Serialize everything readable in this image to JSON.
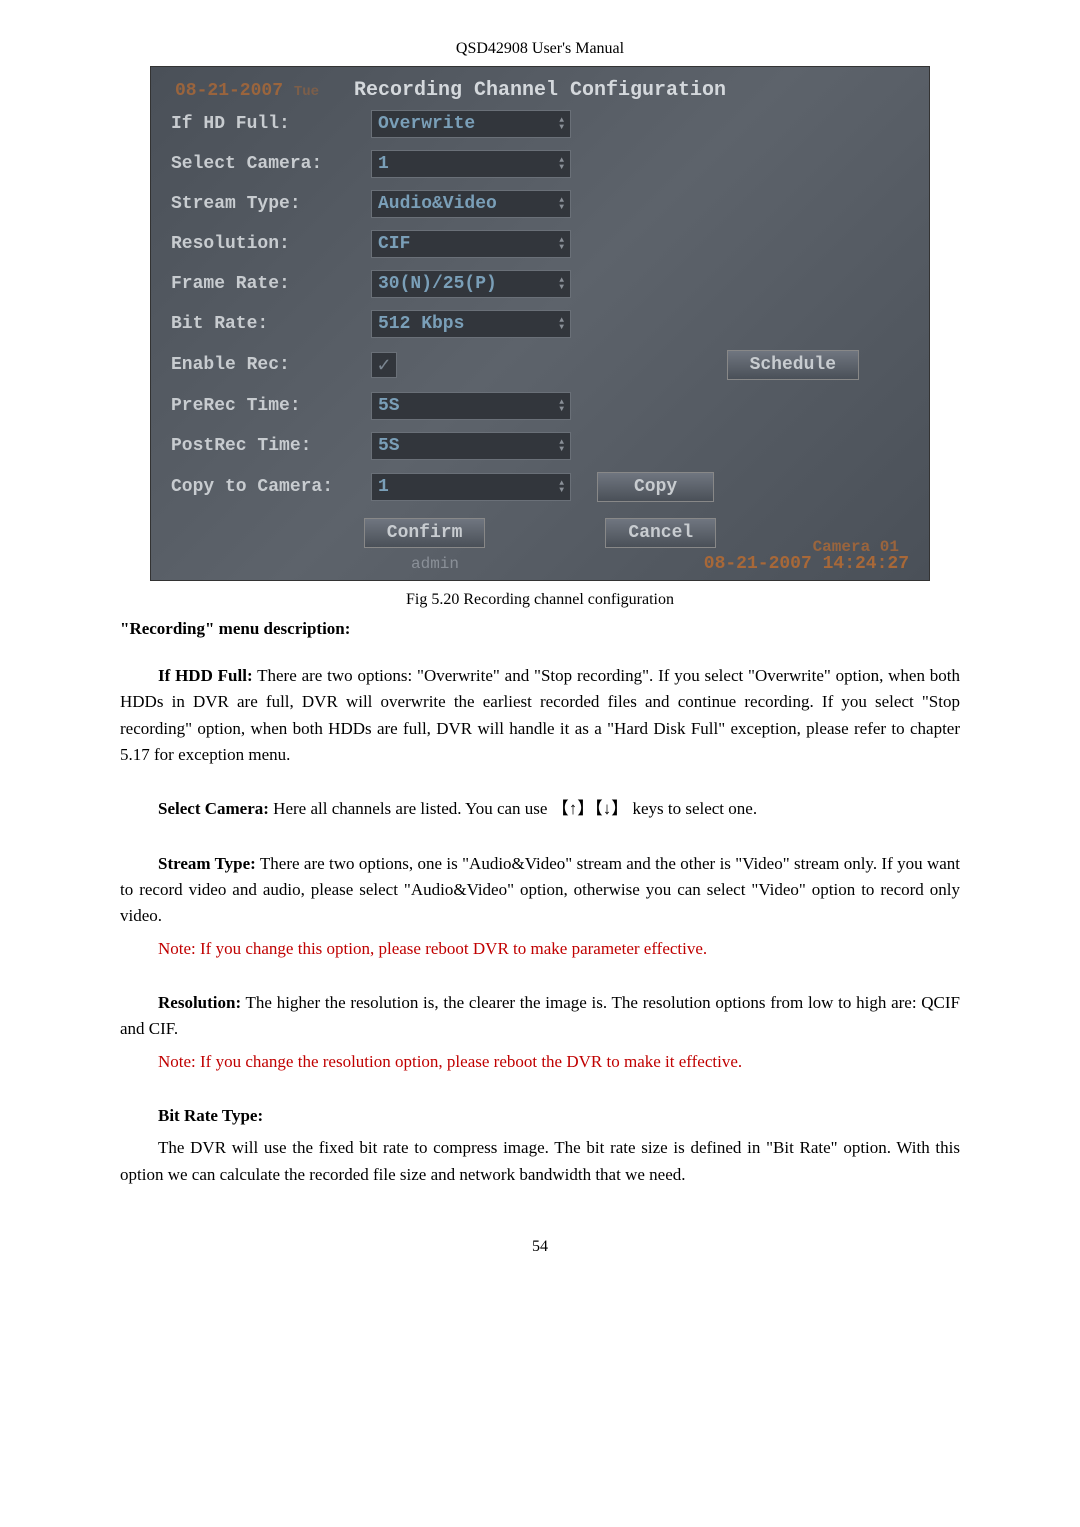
{
  "header": "QSD42908 User's Manual",
  "screenshot": {
    "title": "Recording Channel Configuration",
    "overlay_date_top": "08-21-2007",
    "overlay_tue": "Tue",
    "labels": {
      "if_hd_full": "If HD Full:",
      "select_camera": "Select Camera:",
      "stream_type": "Stream Type:",
      "resolution": "Resolution:",
      "frame_rate": "Frame Rate:",
      "bit_rate": "Bit Rate:",
      "enable_rec": "Enable Rec:",
      "prerec_time": "PreRec Time:",
      "postrec_time": "PostRec Time:",
      "copy_to_camera": "Copy to Camera:"
    },
    "values": {
      "if_hd_full": "Overwrite",
      "select_camera": "1",
      "stream_type": "Audio&Video",
      "resolution": "CIF",
      "frame_rate": "30(N)/25(P)",
      "bit_rate": "512 Kbps",
      "prerec_time": "5S",
      "postrec_time": "5S",
      "copy_to_camera": "1"
    },
    "buttons": {
      "schedule": "Schedule",
      "copy": "Copy",
      "confirm": "Confirm",
      "cancel": "Cancel"
    },
    "footer_user": "admin",
    "footer_camera": "Camera 01",
    "footer_date": "08-21-2007 14:24:27"
  },
  "caption": "Fig 5.20 Recording channel configuration",
  "section_heading": "\"Recording\" menu description:",
  "para1": {
    "lead": "If HDD Full:",
    "text": " There are two options: \"Overwrite\" and \"Stop recording\". If you select \"Overwrite\" option, when both HDDs in DVR are full, DVR will overwrite the earliest recorded files and continue recording. If you select \"Stop recording\" option, when both HDDs are full, DVR will handle it as a \"Hard Disk Full\" exception, please refer to chapter 5.17 for exception menu."
  },
  "para2": {
    "lead": "Select Camera:",
    "text": " Here all channels are listed. You can use 【↑】【↓】 keys to select one."
  },
  "para3": {
    "lead": "Stream Type:",
    "text": " There are two options, one is \"Audio&Video\" stream and the other is \"Video\" stream only. If you want to record video and audio, please select \"Audio&Video\" option, otherwise you can select \"Video\" option to record only video."
  },
  "note1": "Note: If you change this option, please reboot DVR to make parameter effective.",
  "para4": {
    "lead": "Resolution:",
    "text": " The higher the resolution is, the clearer the image is. The resolution options from low to high are: QCIF and CIF."
  },
  "note2": "Note: If you change the resolution option, please reboot the DVR to make it effective.",
  "para5_heading": "Bit Rate Type:",
  "para5_text": "The DVR will use the fixed bit rate to compress image. The bit rate size is defined in \"Bit Rate\" option. With this option we can calculate the recorded file size and network bandwidth that we need.",
  "page_number": "54"
}
